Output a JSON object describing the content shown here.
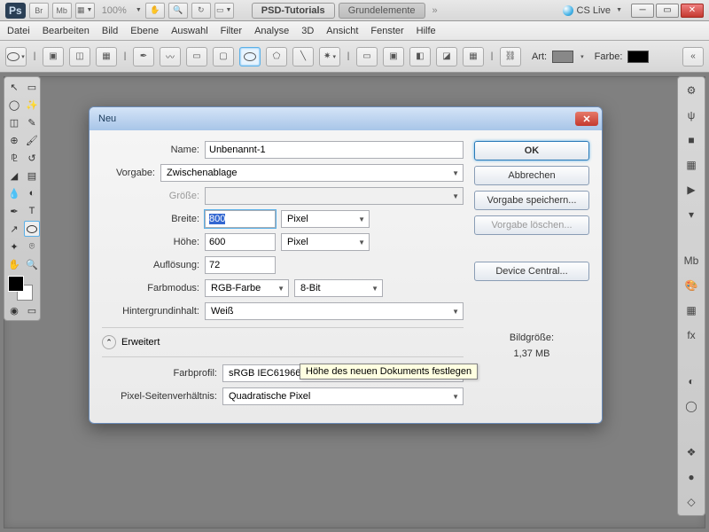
{
  "menubar": {
    "zoom": "100%",
    "tabs": [
      {
        "label": "PSD-Tutorials",
        "active": true
      },
      {
        "label": "Grundelemente",
        "active": false
      }
    ],
    "cslive": "CS Live"
  },
  "menu2": {
    "items": [
      "Datei",
      "Bearbeiten",
      "Bild",
      "Ebene",
      "Auswahl",
      "Filter",
      "Analyse",
      "3D",
      "Ansicht",
      "Fenster",
      "Hilfe"
    ]
  },
  "optsbar": {
    "art": "Art:",
    "farbe": "Farbe:"
  },
  "dialog": {
    "title": "Neu",
    "labels": {
      "name": "Name:",
      "vorgabe": "Vorgabe:",
      "groesse": "Größe:",
      "breite": "Breite:",
      "hoehe": "Höhe:",
      "aufloesung": "Auflösung:",
      "farbmodus": "Farbmodus:",
      "hintergrund": "Hintergrundinhalt:",
      "erweitert": "Erweitert",
      "farbprofil": "Farbprofil:",
      "seitenverh": "Pixel-Seitenverhältnis:"
    },
    "values": {
      "name": "Unbenannt-1",
      "vorgabe": "Zwischenablage",
      "breite": "800",
      "hoehe": "600",
      "aufloesung": "72",
      "farbmodus": "RGB-Farbe",
      "bittiefe": "8-Bit",
      "hintergrund": "Weiß",
      "farbprofil": "sRGB IEC61966-2.1",
      "seitenverh": "Quadratische Pixel",
      "unit_pixel": "Pixel"
    },
    "buttons": {
      "ok": "OK",
      "abbrechen": "Abbrechen",
      "vspeichern": "Vorgabe speichern...",
      "vloeschen": "Vorgabe löschen...",
      "devicecentral": "Device Central..."
    },
    "filesize_label": "Bildgröße:",
    "filesize_value": "1,37 MB",
    "tooltip": "Höhe des neuen Dokuments festlegen"
  }
}
